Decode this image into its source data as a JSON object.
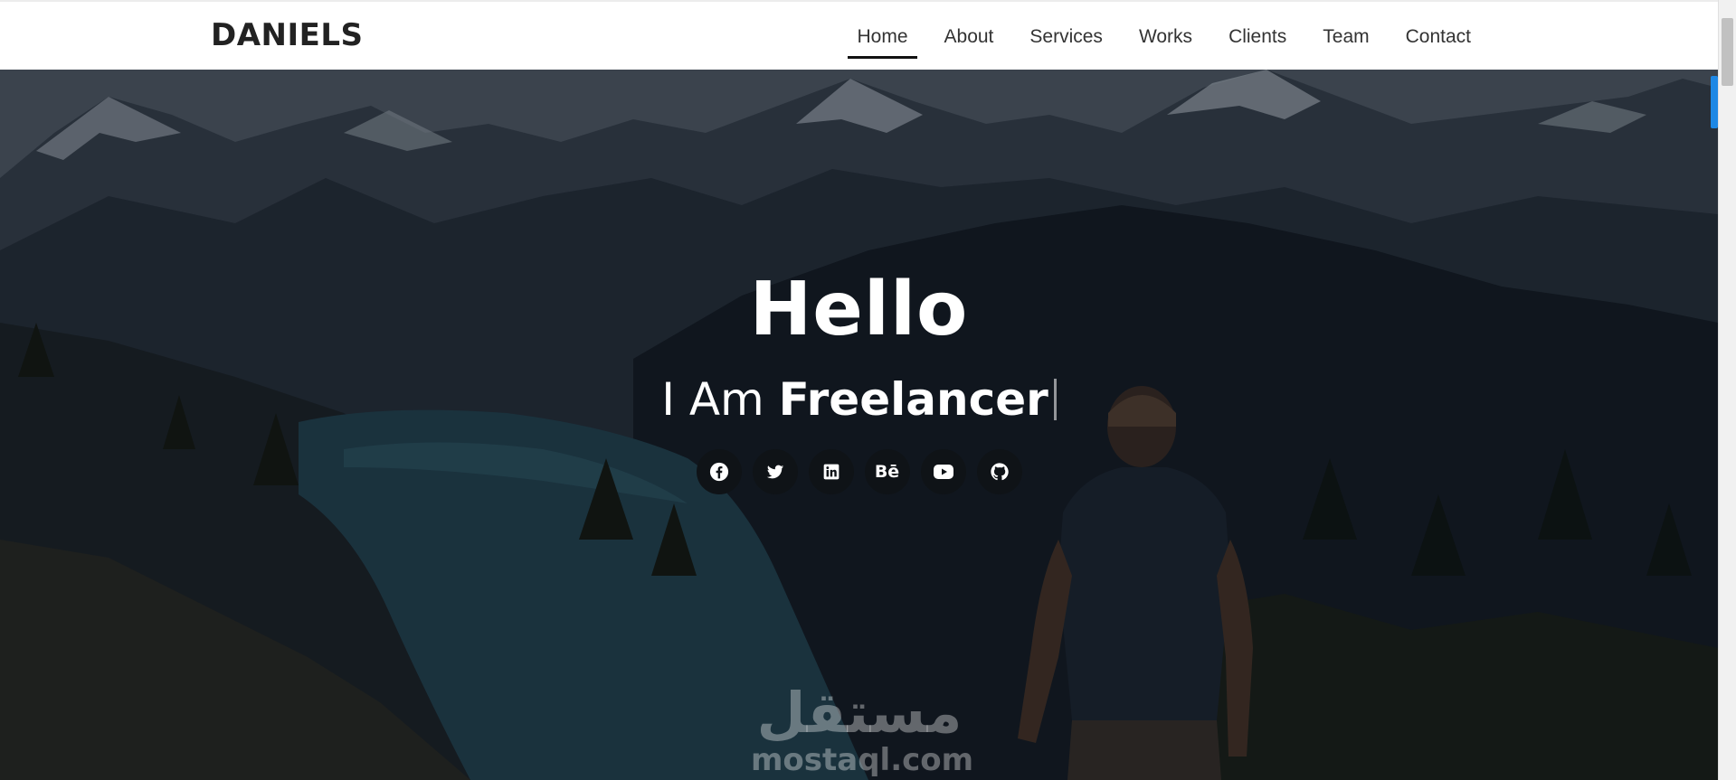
{
  "brand": {
    "name": "DANIELS"
  },
  "nav": {
    "items": [
      {
        "label": "Home",
        "active": true
      },
      {
        "label": "About"
      },
      {
        "label": "Services"
      },
      {
        "label": "Works"
      },
      {
        "label": "Clients"
      },
      {
        "label": "Team"
      },
      {
        "label": "Contact"
      }
    ]
  },
  "hero": {
    "title": "Hello",
    "subtitle_prefix": "I Am",
    "subtitle_role": "Freelancer"
  },
  "socials": [
    {
      "icon": "facebook-icon"
    },
    {
      "icon": "twitter-icon"
    },
    {
      "icon": "linkedin-icon"
    },
    {
      "icon": "behance-icon",
      "glyph": "Bē"
    },
    {
      "icon": "youtube-icon"
    },
    {
      "icon": "github-icon"
    }
  ],
  "watermark": {
    "arabic": "مستقل",
    "latin": "mostaql.com"
  },
  "colors": {
    "accent": "#1e88e5",
    "nav_text": "#333333",
    "brand_text": "#222222"
  }
}
